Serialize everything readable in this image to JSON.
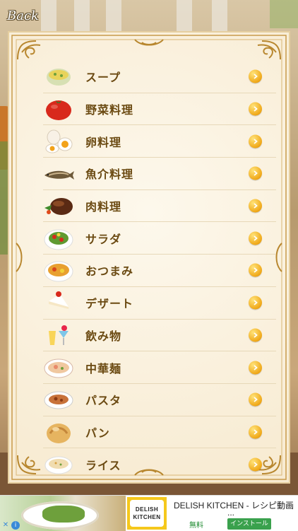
{
  "nav": {
    "back_label": "Back"
  },
  "categories": [
    {
      "label": "スープ",
      "icon": "soup-bowl-icon"
    },
    {
      "label": "野菜料理",
      "icon": "tomato-icon"
    },
    {
      "label": "卵料理",
      "icon": "egg-icon"
    },
    {
      "label": "魚介料理",
      "icon": "fish-icon"
    },
    {
      "label": "肉料理",
      "icon": "meat-icon"
    },
    {
      "label": "サラダ",
      "icon": "salad-icon"
    },
    {
      "label": "おつまみ",
      "icon": "snack-plate-icon"
    },
    {
      "label": "デザート",
      "icon": "cake-icon"
    },
    {
      "label": "飲み物",
      "icon": "drink-icon"
    },
    {
      "label": "中華麺",
      "icon": "noodle-bowl-icon"
    },
    {
      "label": "パスタ",
      "icon": "pasta-plate-icon"
    },
    {
      "label": "パン",
      "icon": "bread-icon"
    },
    {
      "label": "ライス",
      "icon": "rice-bowl-icon"
    }
  ],
  "ad": {
    "brand_line1": "DELISH",
    "brand_line2": "KITCHEN",
    "title": "DELISH KITCHEN - レシピ動画",
    "ellipsis": "...",
    "price": "無料",
    "install_label": "インストール"
  },
  "colors": {
    "accent": "#f0a818",
    "label": "#6b4a12",
    "card": "#fbf3e2",
    "frame": "#c89a4a"
  }
}
